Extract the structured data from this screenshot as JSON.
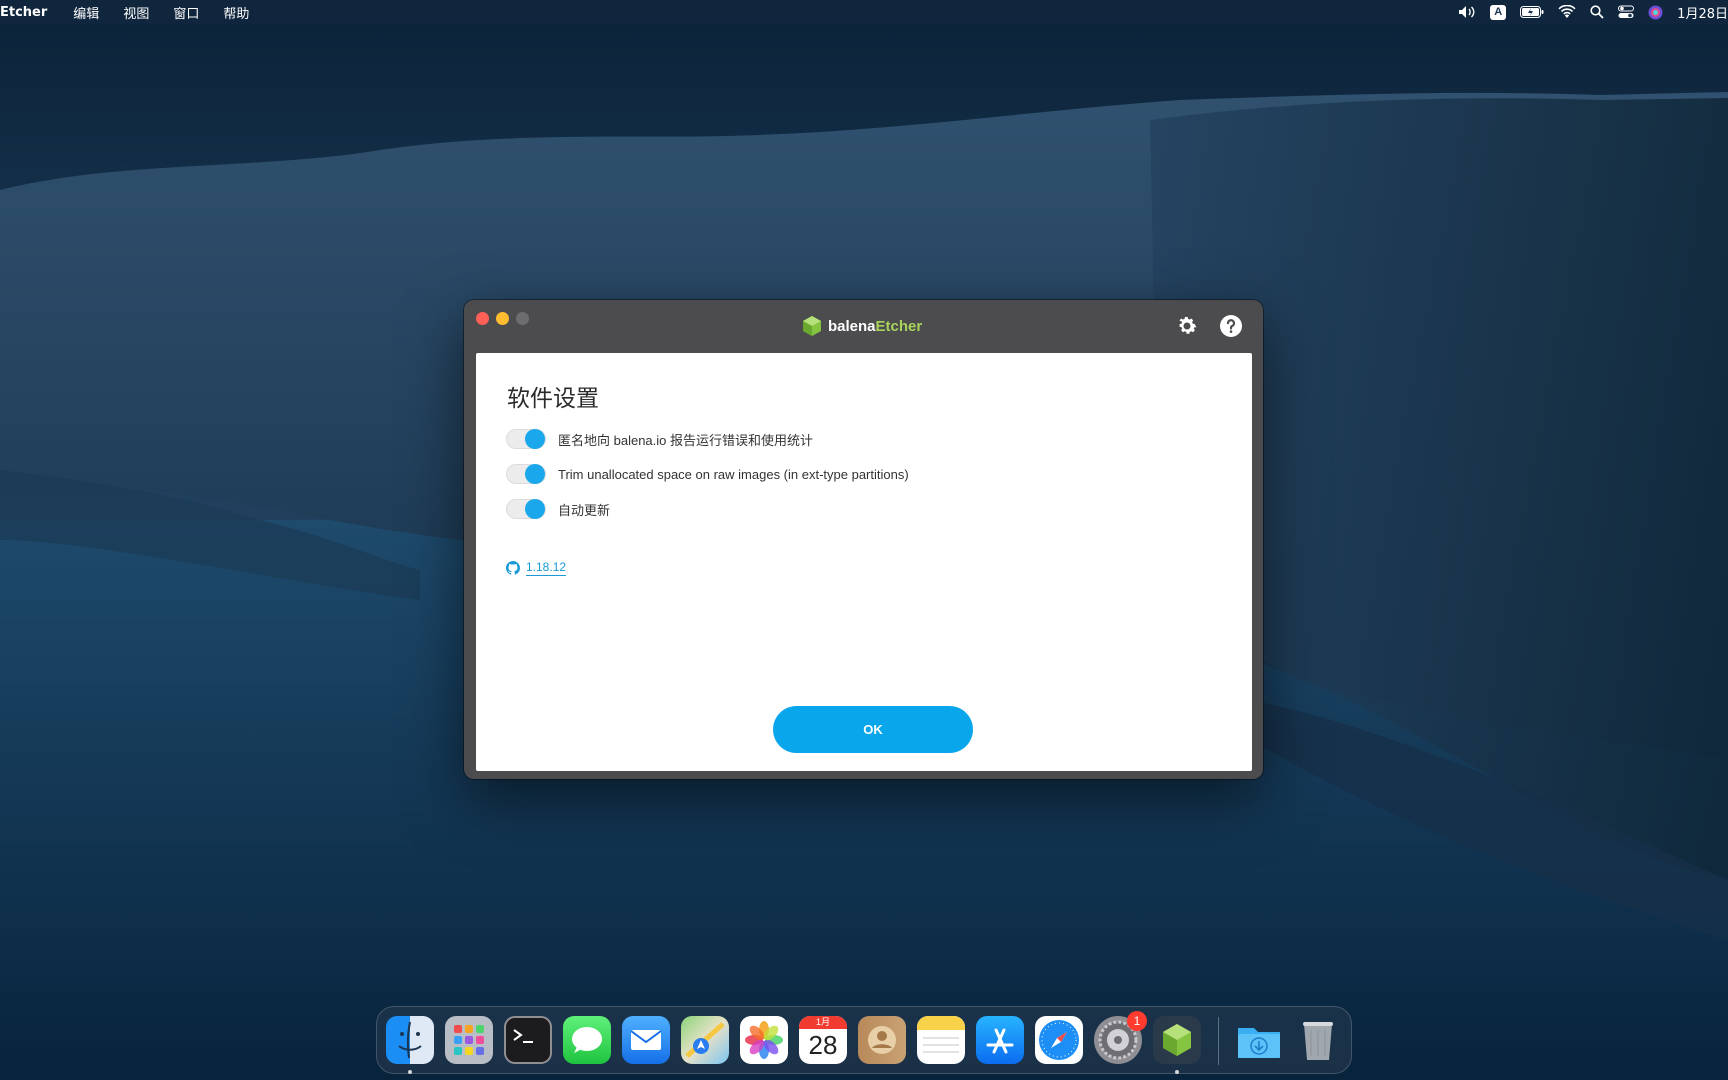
{
  "menubar": {
    "app_name": "Etcher",
    "items": [
      "编辑",
      "视图",
      "窗口",
      "帮助"
    ],
    "input_method": "A",
    "clock": "1月28日"
  },
  "window": {
    "brand_part1": "balena",
    "brand_part2": "Etcher",
    "brand_color": "#a8d35a",
    "settings_title": "软件设置",
    "settings": [
      {
        "label": "匿名地向 balena.io 报告运行错误和使用统计",
        "enabled": true
      },
      {
        "label": "Trim unallocated space on raw images (in ext-type partitions)",
        "enabled": true
      },
      {
        "label": "自动更新",
        "enabled": true
      }
    ],
    "version": "1.18.12",
    "ok_label": "OK",
    "accent_color": "#0aa6ec"
  },
  "dock": {
    "apps": [
      "finder-icon",
      "launchpad-icon",
      "terminal-icon",
      "messages-icon",
      "mail-icon",
      "maps-icon",
      "photos-icon",
      "calendar-icon",
      "contacts-icon",
      "notes-icon",
      "app-store-icon",
      "safari-icon",
      "system-preferences-icon",
      "balena-etcher-icon",
      "downloads-folder-icon",
      "trash-icon"
    ],
    "calendar_month": "1月",
    "calendar_day": "28",
    "system_prefs_badge": "1"
  }
}
